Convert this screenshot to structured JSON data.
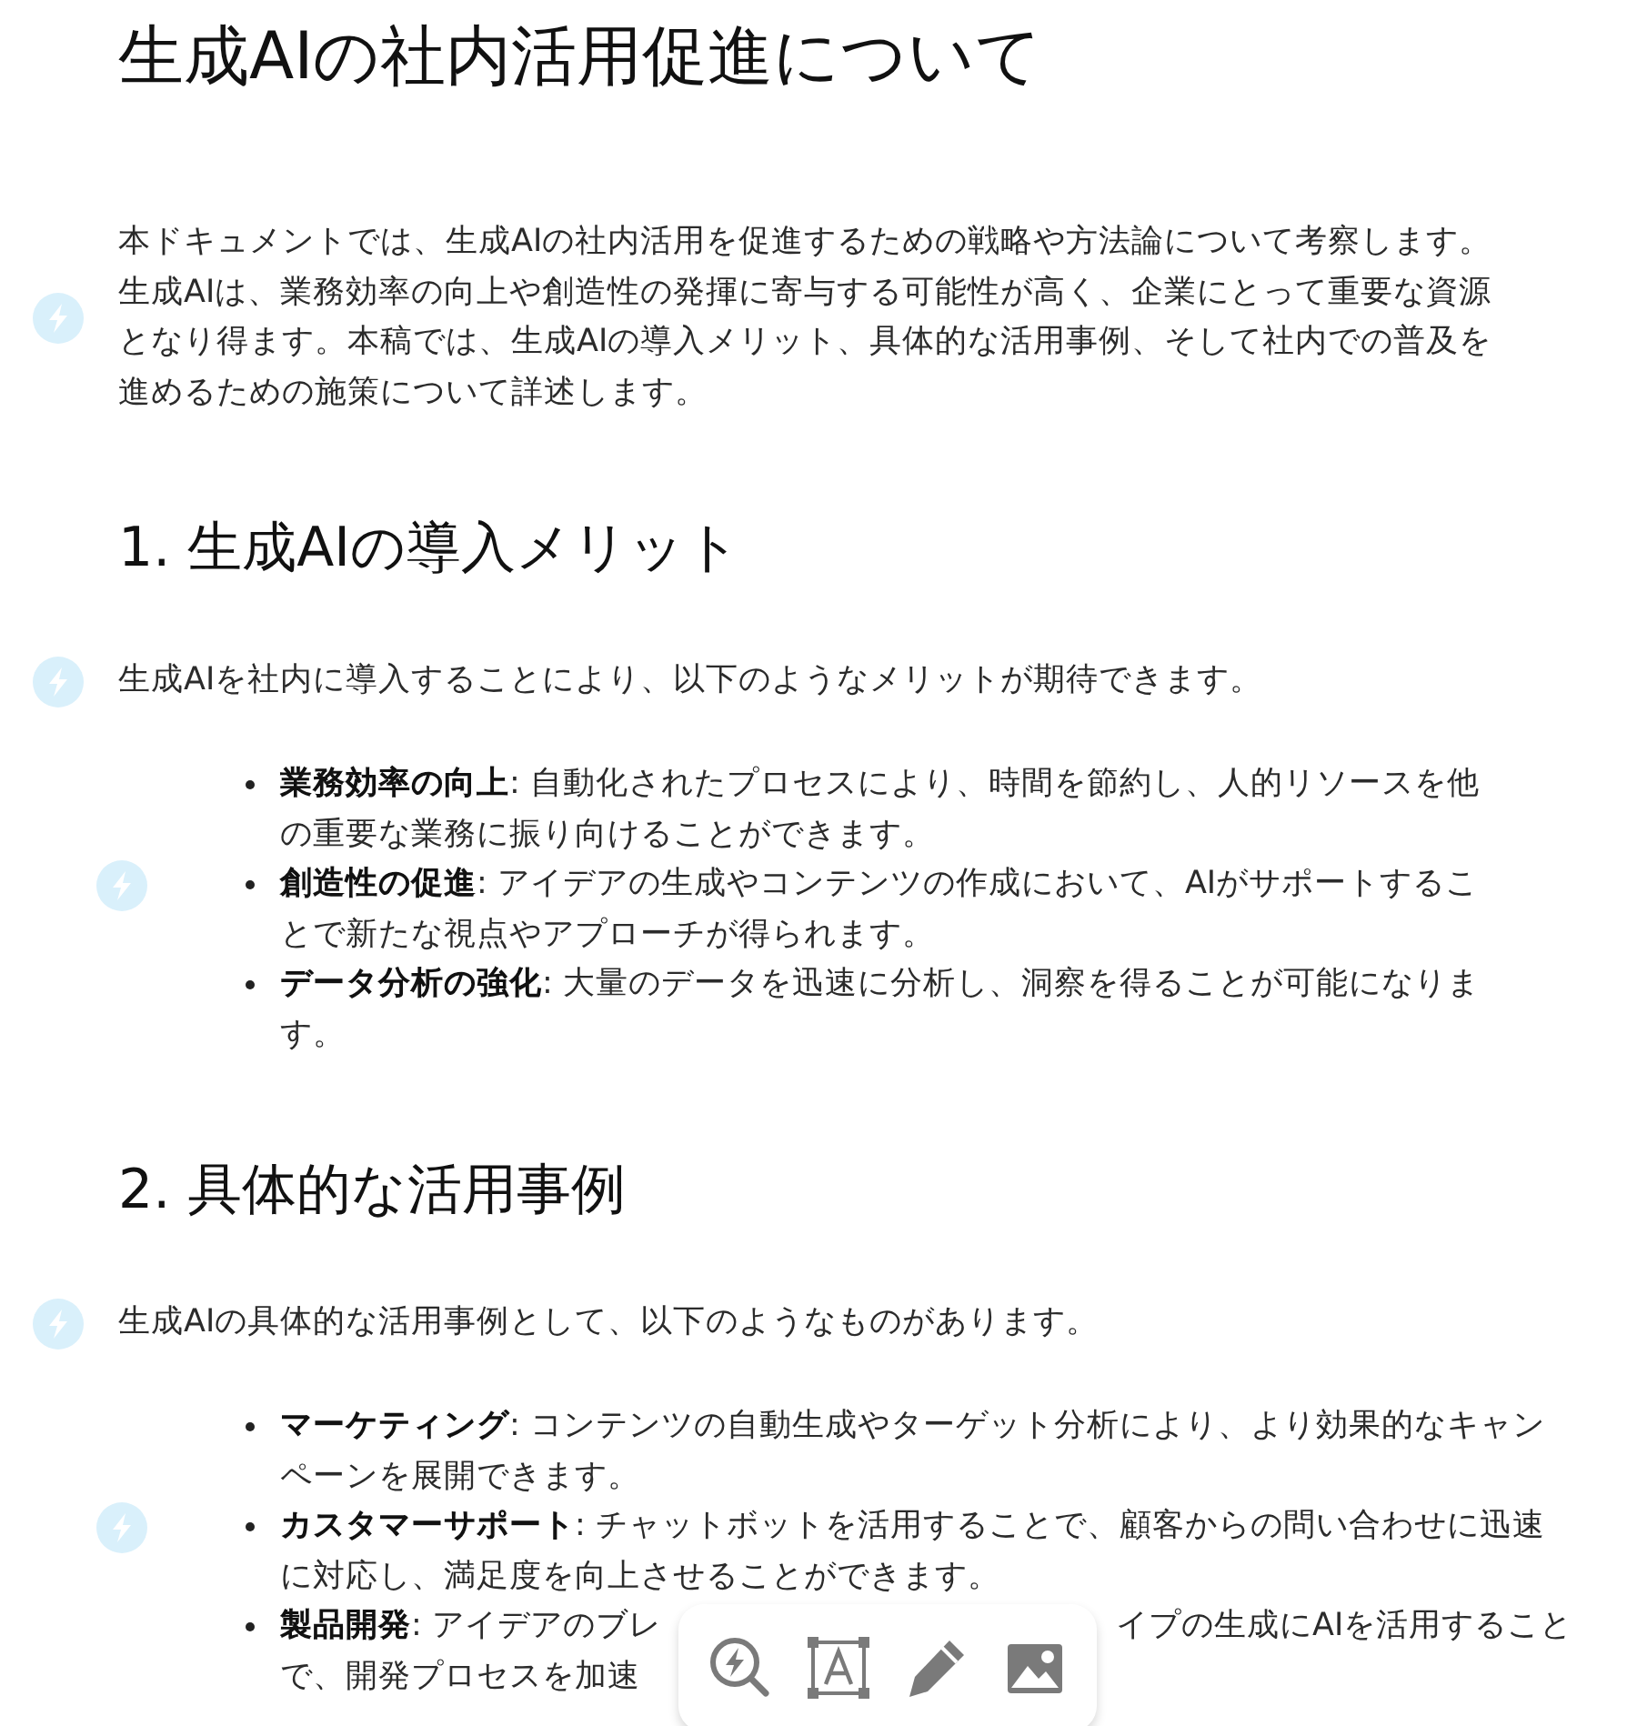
{
  "title": "生成AIの社内活用促進について",
  "blocks": [
    {
      "kind": "paragraph",
      "text": "本ドキュメントでは、生成AIの社内活用を促進するための戦略や方法論について考察します。生成AIは、業務効率の向上や創造性の発揮に寄与する可能性が高く、企業にとって重要な資源となり得ます。本稿では、生成AIの導入メリット、具体的な活用事例、そして社内での普及を進めるための施策について詳述します。"
    },
    {
      "kind": "heading",
      "text": "1. 生成AIの導入メリット"
    },
    {
      "kind": "paragraph",
      "text": "生成AIを社内に導入することにより、以下のようなメリットが期待できます。"
    },
    {
      "kind": "list",
      "items": [
        {
          "text": "**業務効率の向上**: 自動化されたプロセスにより、時間を節約し、人的リソースを他の重要な業務に振り向けることができます。"
        },
        {
          "text": "**創造性の促進**: アイデアの生成やコンテンツの作成において、AIがサポートすることで新たな視点やアプローチが得られます。"
        },
        {
          "text": "**データ分析の強化**: 大量のデータを迅速に分析し、洞察を得ることが可能になります。"
        }
      ]
    },
    {
      "kind": "heading",
      "text": "2. 具体的な活用事例"
    },
    {
      "kind": "paragraph",
      "text": "生成AIの具体的な活用事例として、以下のようなものがあります。"
    },
    {
      "kind": "list",
      "items": [
        {
          "text": "**マーケティング**: コンテンツの自動生成やターゲット分析により、より効果的なキャンペーンを展開できます。"
        },
        {
          "text": "**カスタマーサポート**: チャットボットを活用することで、顧客からの問い合わせに迅速に対応し、満足度を向上させることができます。"
        },
        {
          "text": "**製品開発**: アイデアのブレ",
          "hidden_part": {
            "text_after": "イプの生成にAIを活用すること",
            "next_line": "で、開発プロセスを加速"
          }
        }
      ]
    }
  ],
  "toolbar": {
    "items": [
      {
        "kind": "ai-search"
      },
      {
        "kind": "text"
      },
      {
        "kind": "pen"
      },
      {
        "kind": "image"
      }
    ]
  }
}
